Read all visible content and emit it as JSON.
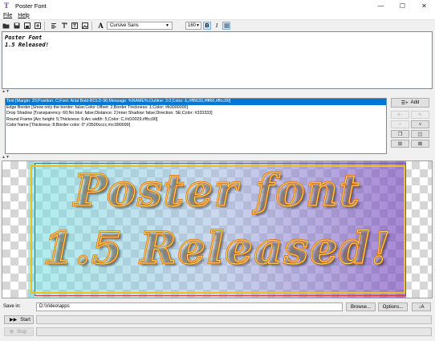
{
  "window": {
    "title": "Poster Font"
  },
  "menu": [
    {
      "label": "File"
    },
    {
      "label": "Help"
    }
  ],
  "toolbar": {
    "font_name": "Cursive Sans",
    "font_size": "160",
    "bold_label": "B",
    "italic_label": "I"
  },
  "editor": {
    "lines": [
      "Poster Font",
      "1.5 Released!"
    ]
  },
  "effects": {
    "items": [
      "Text [Margin: 20;Position: C;Font: Arial Bold-BOLD-96;Message: %NAME%;Outline: 3.0;Color: E,#ff6633,#fff66,#ffcc00]",
      "Edge Border [Show only the border: false;Color Offset: 2;Border Thickness: 1;Color: #b3000000]",
      "Drop Shadow [Transparency: 60;No blur: false;Distance: 2;Inner Shadow: false;Direction: SE;Color: #333333]",
      "Round Frame [Arc height: 5;Thickness: 6;Arc width: 5;Color: C,#d10029,#ffcc00]",
      "Color frame [Thickness: 8;Border color: 0\",#3500cccc,#cc990099]"
    ],
    "selected_index": 0,
    "add_label": "Add"
  },
  "preview": {
    "line1": "Poster font",
    "line2": "1.5 Released!"
  },
  "save": {
    "label": "Save in:",
    "path": "D:\\Video\\apps",
    "browse_label": "Browse...",
    "options_label": "Options..."
  },
  "run": {
    "start_label": "Start",
    "stop_label": "Stop"
  },
  "colors": {
    "selection": "#0078d7",
    "accent_purple": "#7b3fbf"
  }
}
